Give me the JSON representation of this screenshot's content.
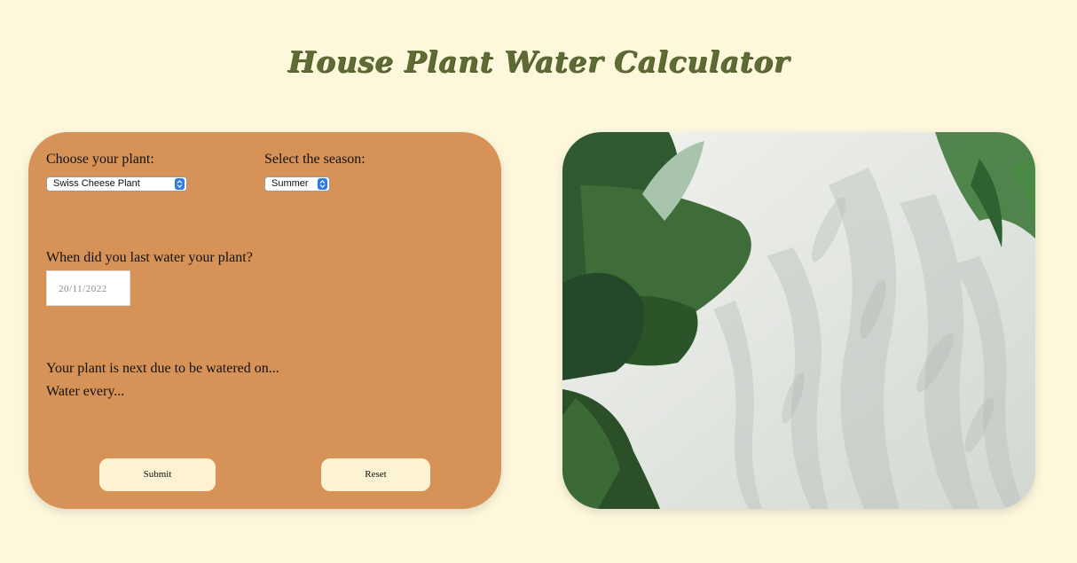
{
  "page": {
    "title": "House Plant Water Calculator"
  },
  "form": {
    "plant_label": "Choose your plant:",
    "plant_value": "Swiss Cheese Plant",
    "season_label": "Select the season:",
    "season_value": "Summer",
    "last_water_label": "When did you last water your plant?",
    "date_value": "20/11/2022",
    "next_due_text": "Your plant is next due to be watered on...",
    "frequency_text": "Water every...",
    "submit_label": "Submit",
    "reset_label": "Reset"
  },
  "colors": {
    "background": "#fdf7dc",
    "title": "#5e6b34",
    "card": "#d79357",
    "button": "#fdf3d3",
    "select_accent": "#2f7be8"
  },
  "icons": [
    "updown-chevron-icon"
  ]
}
